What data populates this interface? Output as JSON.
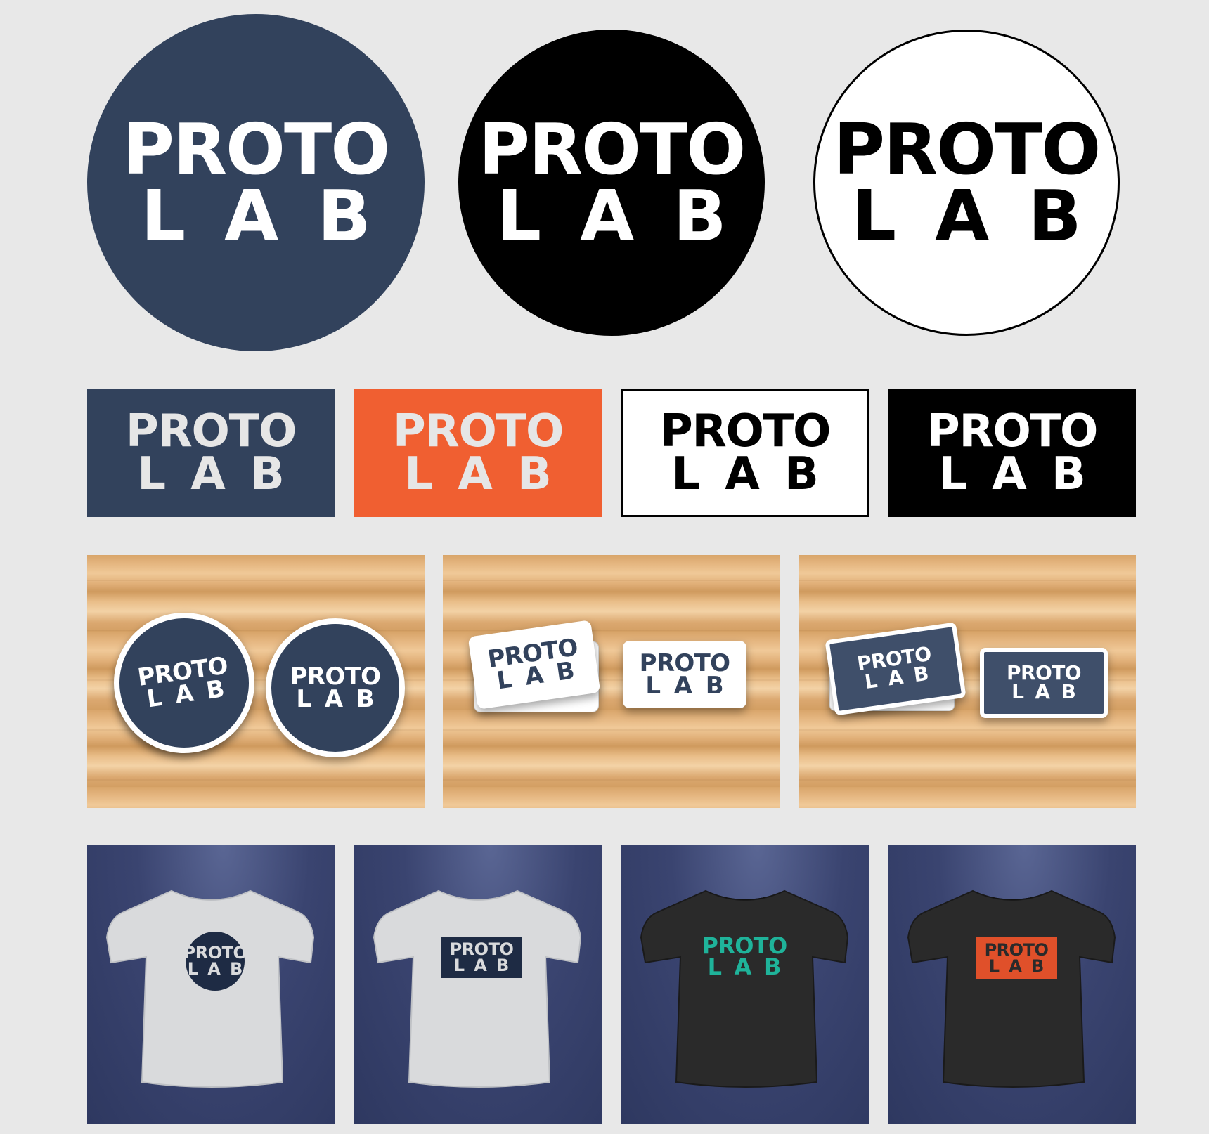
{
  "logo": {
    "word1": "PROTO",
    "word2": "LAB"
  },
  "colors": {
    "background": "#e8e8e8",
    "navy": "#32425c",
    "orange": "#f05f31",
    "black": "#000000",
    "white": "#ffffff",
    "light_gray_text": "#e6e6e6",
    "teal": "#1fb39a",
    "shirt_white": "#d9dadc",
    "shirt_black": "#2a2a2a",
    "backdrop_blue": "#3a4470"
  },
  "variants": {
    "circles": [
      "navy",
      "black",
      "white-outlined"
    ],
    "rectangles": [
      "navy",
      "orange",
      "white-outlined",
      "black"
    ],
    "stickers": [
      "round-navy",
      "rect-white",
      "rect-navy"
    ],
    "shirts": [
      "white-shirt-navy-circle",
      "white-shirt-navy-rect",
      "black-shirt-teal-text",
      "black-shirt-orange-rect"
    ]
  },
  "icons": {
    "tshirt": "tshirt-icon"
  }
}
